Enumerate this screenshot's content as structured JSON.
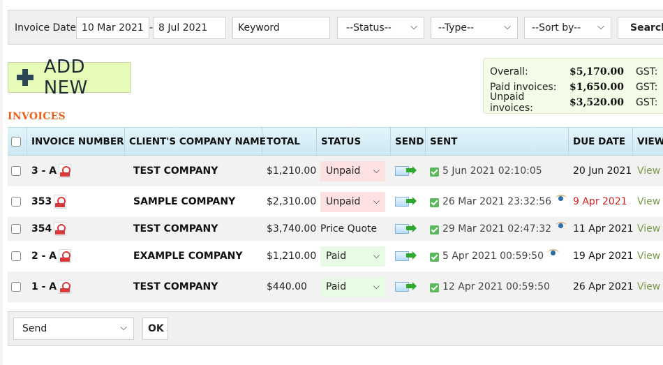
{
  "filters": {
    "invoice_date_label": "Invoice Date:",
    "date_from": "10 Mar 2021",
    "date_separator": "-",
    "date_to": "8 Jul 2021",
    "keyword_placeholder": "Keyword",
    "status_select": "--Status--",
    "type_select": "--Type--",
    "sort_select": "--Sort by--",
    "search_button": "Search"
  },
  "add_new": {
    "icon": "plus-icon",
    "label": "ADD NEW"
  },
  "section_title": "INVOICES",
  "summary": [
    {
      "label": "Overall:",
      "value": "$5,170.00",
      "gst_label": "GST:"
    },
    {
      "label": "Paid invoices:",
      "value": "$1,650.00",
      "gst_label": "GST:"
    },
    {
      "label": "Unpaid invoices:",
      "value": "$3,520.00",
      "gst_label": "GST:"
    }
  ],
  "table": {
    "headers": {
      "invoice_number": "INVOICE NUMBER",
      "company": "CLIENT'S COMPANY NAME",
      "total": "TOTAL",
      "status": "STATUS",
      "send": "SEND",
      "sent": "SENT",
      "due_date": "DUE DATE",
      "view": "VIEW"
    },
    "rows": [
      {
        "invoice": "3 - A",
        "company": "TEST COMPANY",
        "total": "$1,210.00",
        "status": "Unpaid",
        "status_type": "select",
        "sent": "5 Jun 2021 02:10:05",
        "viewed": false,
        "due": "20 Jun 2021",
        "overdue": false,
        "view": "View"
      },
      {
        "invoice": "353",
        "company": "SAMPLE COMPANY",
        "total": "$2,310.00",
        "status": "Unpaid",
        "status_type": "select",
        "sent": "26 Mar 2021 23:32:56",
        "viewed": true,
        "due": "9 Apr 2021",
        "overdue": true,
        "view": "View"
      },
      {
        "invoice": "354",
        "company": "TEST COMPANY",
        "total": "$3,740.00",
        "status": "Price Quote",
        "status_type": "text",
        "sent": "29 Mar 2021 02:47:32",
        "viewed": true,
        "due": "11 Apr 2021",
        "overdue": false,
        "view": "View"
      },
      {
        "invoice": "2 - A",
        "company": "EXAMPLE COMPANY",
        "total": "$1,210.00",
        "status": "Paid",
        "status_type": "select",
        "sent": "5 Apr 2021 00:59:50",
        "viewed": true,
        "due": "19 Apr 2021",
        "overdue": false,
        "view": "View"
      },
      {
        "invoice": "1 - A",
        "company": "TEST COMPANY",
        "total": "$440.00",
        "status": "Paid",
        "status_type": "select",
        "sent": "12 Apr 2021 00:59:50",
        "viewed": false,
        "due": "26 Apr 2021",
        "overdue": false,
        "view": "View"
      }
    ]
  },
  "bulk_action": {
    "selected": "Send",
    "ok_button": "OK"
  },
  "colors": {
    "section_title": "#e8621c",
    "add_new_bg": "#e6fbb8",
    "unpaid_bg": "#fde0e0",
    "paid_bg": "#e8fbe5",
    "overdue": "#d42020",
    "view_link": "#7a9a4a",
    "header_bg": "#d6edf6"
  }
}
